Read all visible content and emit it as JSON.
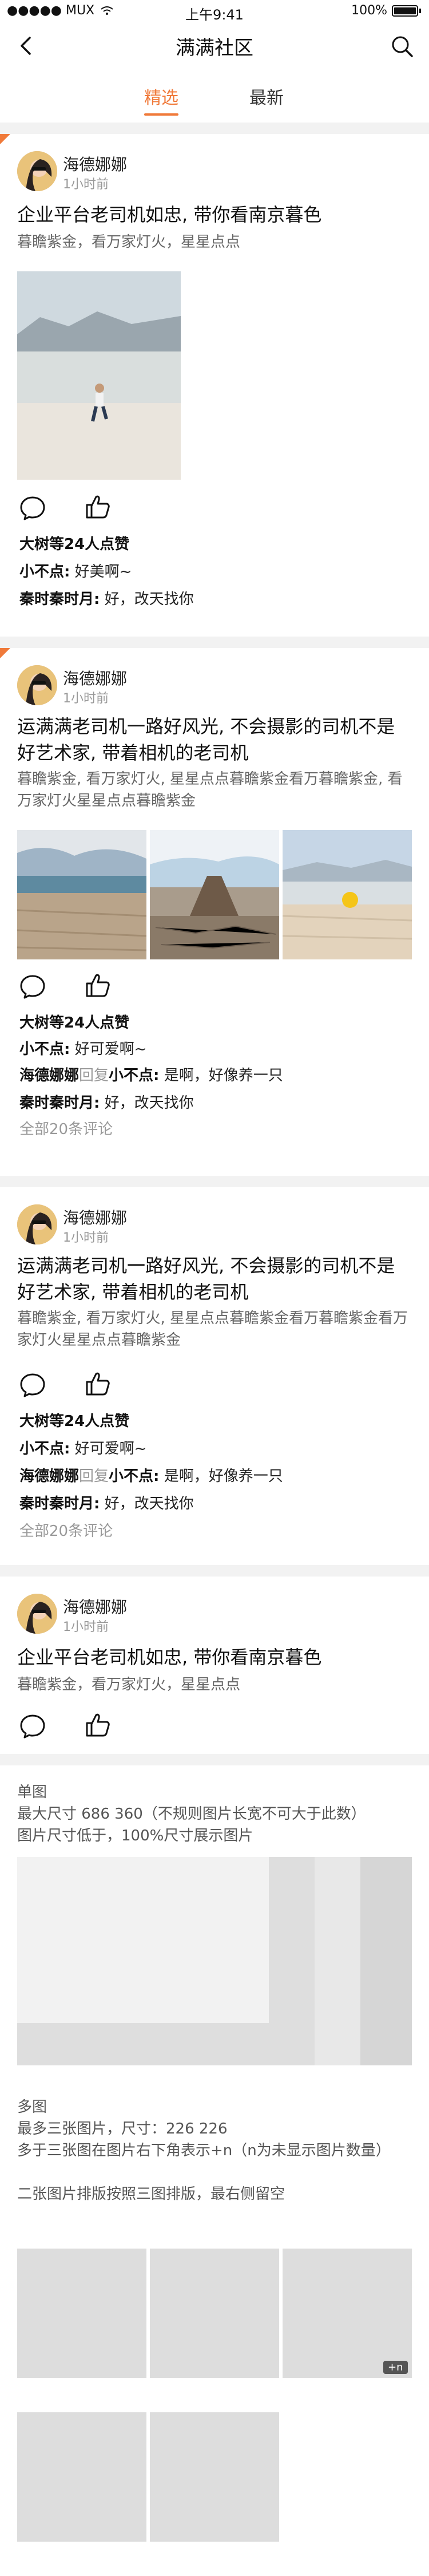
{
  "status": {
    "carrier": "●●●●● MUX",
    "time": "上午9:41",
    "battery": "100%"
  },
  "nav": {
    "title": "满满社区",
    "back_icon": "back-arrow-icon",
    "search_icon": "search-icon"
  },
  "tabs": [
    {
      "label": "精选",
      "active": true
    },
    {
      "label": "最新",
      "active": false
    }
  ],
  "colors": {
    "accent": "#f07a3a",
    "separator": "#f2f2f2",
    "placeholder": "#dddddd"
  },
  "posts": [
    {
      "username": "海德娜娜",
      "time": "1小时前",
      "title": "企业平台老司机如忠, 带你看南京暮色",
      "desc": "暮瞻紫金，看万家灯火，星星点点",
      "likes": "大树等24人点赞",
      "comments": [
        {
          "name": "小不点:",
          "text": " 好美啊~"
        },
        {
          "name": "秦时秦时月:",
          "text": " 好，改天找你"
        }
      ]
    },
    {
      "username": "海德娜娜",
      "time": "1小时前",
      "title": "运满满老司机一路好风光, 不会摄影的司机不是好艺术家, 带着相机的老司机",
      "desc": "暮瞻紫金, 看万家灯火, 星星点点暮瞻紫金看万暮瞻紫金, 看万家灯火星星点点暮瞻紫金",
      "likes": "大树等24人点赞",
      "comments": [
        {
          "name": "小不点:",
          "text": " 好可爱啊~"
        },
        {
          "name": "海德娜娜",
          "reply": "回复",
          "name2": "小不点:",
          "text": " 是啊，好像养一只"
        },
        {
          "name": "秦时秦时月:",
          "text": " 好，改天找你"
        }
      ],
      "all_comments": "全部20条评论"
    },
    {
      "username": "海德娜娜",
      "time": "1小时前",
      "title": "运满满老司机一路好风光, 不会摄影的司机不是好艺术家, 带着相机的老司机",
      "desc": "暮瞻紫金, 看万家灯火, 星星点点暮瞻紫金看万暮瞻紫金看万家灯火星星点点暮瞻紫金",
      "likes": "大树等24人点赞",
      "comments": [
        {
          "name": "小不点:",
          "text": " 好可爱啊~"
        },
        {
          "name": "海德娜娜",
          "reply": "回复",
          "name2": "小不点:",
          "text": " 是啊，好像养一只"
        },
        {
          "name": "秦时秦时月:",
          "text": " 好，改天找你"
        }
      ],
      "all_comments": "全部20条评论"
    },
    {
      "username": "海德娜娜",
      "time": "1小时前",
      "title": "企业平台老司机如忠, 带你看南京暮色",
      "desc": "暮瞻紫金，看万家灯火，星星点点"
    }
  ],
  "spec": {
    "single_title": "单图",
    "single_line1": "最大尺寸  686 360（不规则图片长宽不可大于此数）",
    "single_line2": "图片尺寸低于，100%尺寸展示图片",
    "multi_title": "多图",
    "multi_line1": "最多三张图片，尺寸：226 226",
    "multi_line2": "多于三张图在图片右下角表示+n（n为未显示图片数量）",
    "multi_line3": "二张图片排版按照三图排版，最右侧留空",
    "more_badge": "+n"
  }
}
